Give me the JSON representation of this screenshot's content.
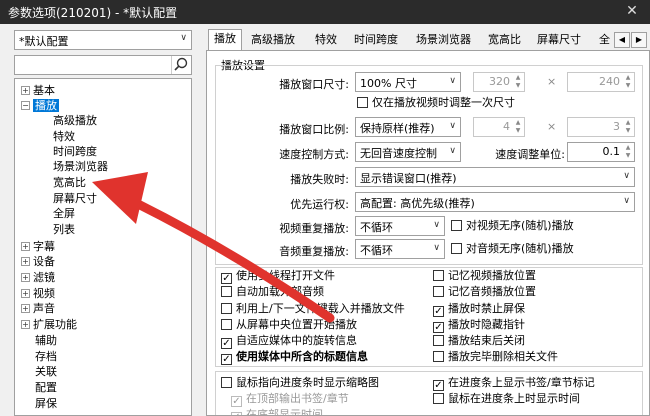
{
  "window": {
    "title": "参数选项(210201) - *默认配置"
  },
  "profile": {
    "selected": "*默认配置"
  },
  "tree": [
    {
      "label": "基本",
      "toggle": "+"
    },
    {
      "label": "播放",
      "toggle": "-"
    },
    {
      "label": "高级播放"
    },
    {
      "label": "特效"
    },
    {
      "label": "时间跨度"
    },
    {
      "label": "场景浏览器"
    },
    {
      "label": "宽高比"
    },
    {
      "label": "屏幕尺寸"
    },
    {
      "label": "全屏"
    },
    {
      "label": "列表"
    },
    {
      "label": "字幕",
      "toggle": "+"
    },
    {
      "label": "设备",
      "toggle": "+"
    },
    {
      "label": "滤镜",
      "toggle": "+"
    },
    {
      "label": "视频",
      "toggle": "+"
    },
    {
      "label": "声音",
      "toggle": "+"
    },
    {
      "label": "扩展功能",
      "toggle": "+"
    },
    {
      "label": "辅助"
    },
    {
      "label": "存档"
    },
    {
      "label": "关联"
    },
    {
      "label": "配置"
    },
    {
      "label": "屏保"
    }
  ],
  "tabs": [
    "播放",
    "高级播放",
    "特效",
    "时间跨度",
    "场景浏览器",
    "宽高比",
    "屏幕尺寸",
    "全"
  ],
  "panel": {
    "group_title": "播放设置",
    "window_size": {
      "label": "播放窗口尺寸:",
      "value": "100% 尺寸",
      "w": "320",
      "h": "240",
      "x": "×"
    },
    "resize_once": "仅在播放视频时调整一次尺寸",
    "aspect": {
      "label": "播放窗口比例:",
      "value": "保持原样(推荐)",
      "a": "4",
      "b": "3",
      "x": "×"
    },
    "speed": {
      "label": "速度控制方式:",
      "value": "无回音速度控制",
      "unit_label": "速度调整单位:",
      "unit_value": "0.1"
    },
    "on_fail": {
      "label": "播放失败时:",
      "value": "显示错误窗口(推荐)"
    },
    "priority": {
      "label": "优先运行权:",
      "value": "高配置: 高优先级(推荐)"
    },
    "video_repeat": {
      "label": "视频重复播放:",
      "value": "不循环",
      "random": "对视频无序(随机)播放"
    },
    "audio_repeat": {
      "label": "音频重复播放:",
      "value": "不循环",
      "random": "对音频无序(随机)播放"
    },
    "options_left": [
      {
        "label": "使用多线程打开文件",
        "checked": true
      },
      {
        "label": "自动加载外部音频",
        "checked": false
      },
      {
        "label": "利用上/下一文件键载入并播放文件",
        "checked": false
      },
      {
        "label": "从屏幕中央位置开始播放",
        "checked": false
      },
      {
        "label": "自适应媒体中的旋转信息",
        "checked": true
      },
      {
        "label": "使用媒体中所含的标题信息",
        "checked": true,
        "bold": true
      }
    ],
    "options_right": [
      {
        "label": "记忆视频播放位置",
        "checked": false
      },
      {
        "label": "记忆音频播放位置",
        "checked": false
      },
      {
        "label": "播放时禁止屏保",
        "checked": true
      },
      {
        "label": "播放时隐藏指针",
        "checked": true
      },
      {
        "label": "播放结束后关闭",
        "checked": false
      },
      {
        "label": "播放完毕删除相关文件",
        "checked": false
      }
    ],
    "thumb_left": {
      "label": "鼠标指向进度条时显示缩略图",
      "checked": false
    },
    "thumb_right": {
      "label": "在进度条上显示书签/章节标记",
      "checked": true
    },
    "thumb_sub1": {
      "label": "在顶部输出书签/章节",
      "checked": true
    },
    "thumb_right2": {
      "label": "鼠标在进度条上时显示时间",
      "checked": false
    },
    "thumb_sub2": {
      "label": "在底部显示时间",
      "checked": true
    }
  }
}
